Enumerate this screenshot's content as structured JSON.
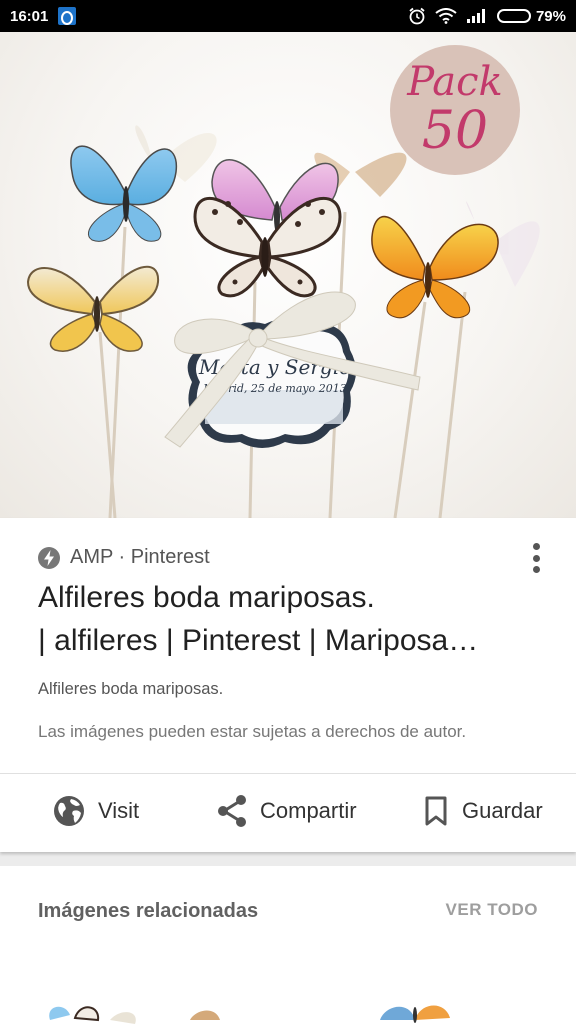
{
  "status_bar": {
    "time": "16:01",
    "battery_percent": "79%",
    "battery_level": 0.79
  },
  "image": {
    "badge_word": "Pack",
    "badge_number": "50",
    "tag_line1": "Marta y Sergio",
    "tag_line2": "Madrid, 25 de mayo 2013"
  },
  "result": {
    "source": "AMP · Pinterest",
    "title_line1": "Alfileres boda mariposas.",
    "title_line2": "| alfileres | Pinterest | Mariposa…",
    "description": "Alfileres boda mariposas.",
    "rights_notice": "Las imágenes pueden estar sujetas a derechos de autor."
  },
  "actions": {
    "visit": "Visit",
    "share": "Compartir",
    "save": "Guardar"
  },
  "related": {
    "title": "Imágenes relacionadas",
    "see_all": "VER TODO"
  }
}
